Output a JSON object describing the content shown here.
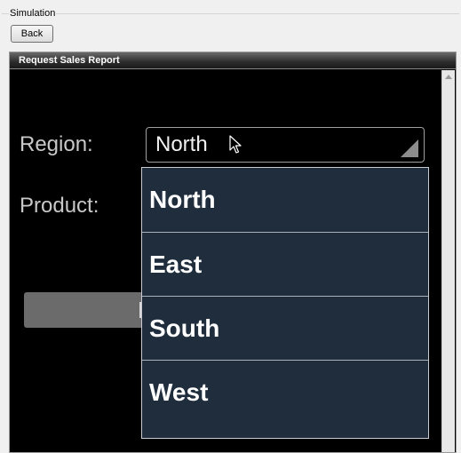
{
  "simulation": {
    "group_label": "Simulation",
    "back_label": "Back"
  },
  "panel": {
    "title": "Request Sales Report"
  },
  "form": {
    "region_label": "Region:",
    "product_label": "Product:",
    "region_value": "North"
  },
  "dropdown": {
    "options": [
      "North",
      "East",
      "South",
      "West"
    ]
  },
  "icons": {
    "cursor": "arrow-cursor-icon",
    "dropdown": "chevron-corner-icon",
    "scroll_up": "scroll-up-arrow-icon"
  }
}
